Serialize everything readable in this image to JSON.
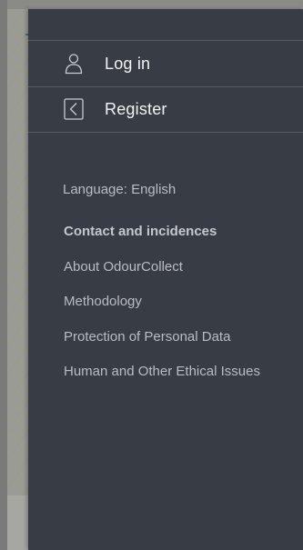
{
  "drawer": {
    "menu": {
      "login": {
        "label": "Log in",
        "icon": "user-icon"
      },
      "register": {
        "label": "Register",
        "icon": "register-icon"
      }
    },
    "language": "Language: English",
    "links": [
      "Contact and incidences",
      "About OdourCollect",
      "Methodology",
      "Protection of Personal Data",
      "Human and Other Ethical Issues"
    ]
  },
  "colors": {
    "drawer_bg": "#383d45",
    "text_primary": "#f2f3f5",
    "text_secondary": "#b9bcc2",
    "divider": "#565c66"
  }
}
